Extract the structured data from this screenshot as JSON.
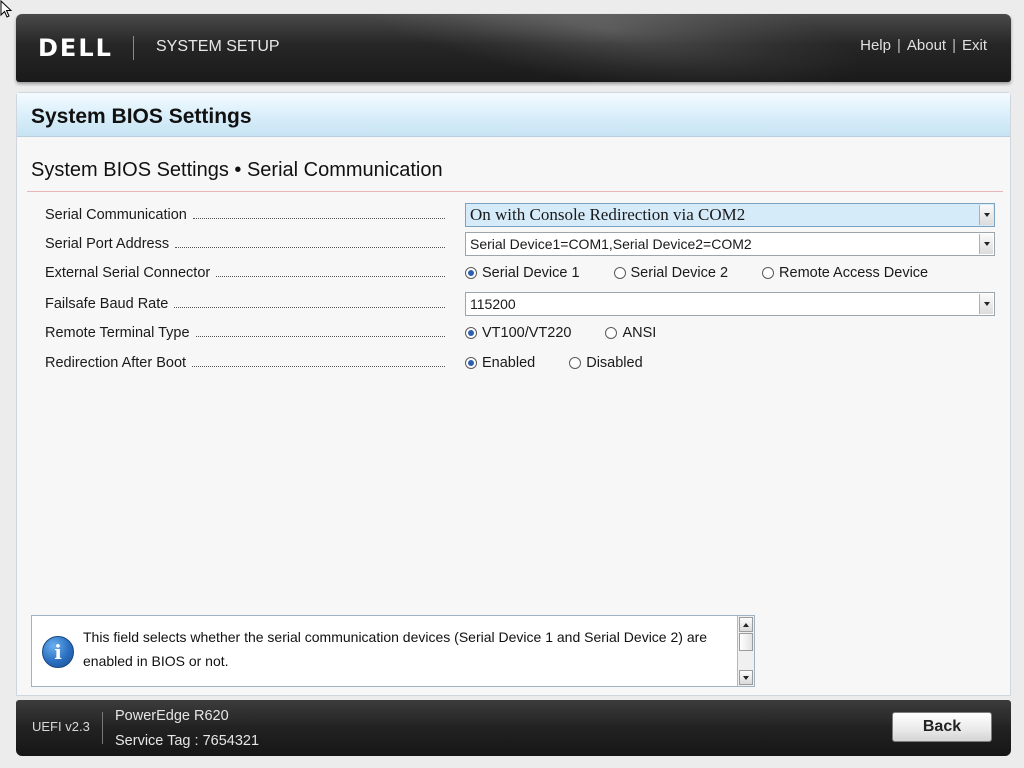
{
  "header": {
    "logo_text": "DELL",
    "title": "SYSTEM SETUP",
    "links": {
      "help": "Help",
      "about": "About",
      "exit": "Exit"
    }
  },
  "panel": {
    "title": "System BIOS Settings",
    "breadcrumb": "System BIOS Settings • Serial Communication"
  },
  "settings": {
    "serial_communication": {
      "label": "Serial Communication",
      "value": "On with Console Redirection via COM2"
    },
    "serial_port_address": {
      "label": "Serial Port Address",
      "value": "Serial Device1=COM1,Serial Device2=COM2"
    },
    "external_serial_connector": {
      "label": "External Serial Connector",
      "options": [
        "Serial Device 1",
        "Serial Device 2",
        "Remote Access Device"
      ],
      "selected": "Serial Device 1"
    },
    "failsafe_baud_rate": {
      "label": "Failsafe Baud Rate",
      "value": "115200"
    },
    "remote_terminal_type": {
      "label": "Remote Terminal Type",
      "options": [
        "VT100/VT220",
        "ANSI"
      ],
      "selected": "VT100/VT220"
    },
    "redirection_after_boot": {
      "label": "Redirection After Boot",
      "options": [
        "Enabled",
        "Disabled"
      ],
      "selected": "Enabled"
    }
  },
  "help": {
    "line1": "This field selects whether the serial communication devices (Serial Device 1 and Serial Device 2) are",
    "line2": "enabled in BIOS or not."
  },
  "footer": {
    "uefi_version": "UEFI v2.3",
    "model": "PowerEdge R620",
    "service_tag": "Service Tag : 7654321",
    "back_label": "Back"
  },
  "colors": {
    "header_dark": "#1a1a1a",
    "panel_header_blue": "#d8eefa",
    "focus_field": "#d6ebf9",
    "radio_selected": "#2d5fb0",
    "info_icon": "#2a6fc0"
  }
}
